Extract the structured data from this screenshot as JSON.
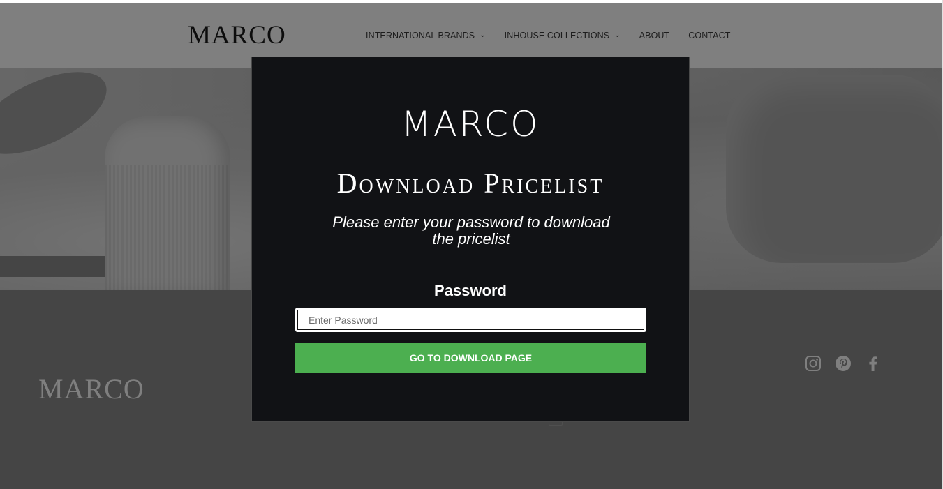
{
  "header": {
    "logo": "MARCO",
    "nav": [
      {
        "label": "INTERNATIONAL BRANDS",
        "has_dropdown": true
      },
      {
        "label": "INHOUSE COLLECTIONS",
        "has_dropdown": true
      },
      {
        "label": "ABOUT",
        "has_dropdown": false
      },
      {
        "label": "CONTACT",
        "has_dropdown": false
      }
    ]
  },
  "footer": {
    "logo": "MARCO",
    "social": [
      "instagram-icon",
      "pinterest-icon",
      "facebook-icon"
    ]
  },
  "modal": {
    "logo": "MARCO",
    "title": "Download Pricelist",
    "subtitle_line1": "Please enter your password to download",
    "subtitle_line2": "the pricelist",
    "password_label": "Password",
    "password_placeholder": "Enter Password",
    "password_value": "",
    "submit_label": "GO TO DOWNLOAD PAGE"
  },
  "colors": {
    "modal_bg": "#111215",
    "button": "#4caf50",
    "overlay": "rgba(0,0,0,0.5)"
  }
}
